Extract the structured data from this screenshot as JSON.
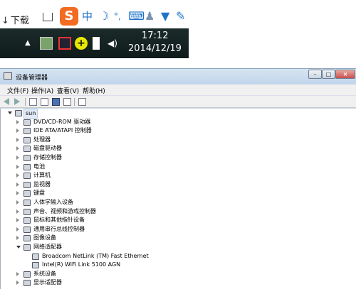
{
  "browser": {
    "download_label": "下载"
  },
  "ime": {
    "logo": "S",
    "mode_label": "中",
    "icons": [
      "moon-icon",
      "punctuation-icon",
      "keyboard-icon",
      "user-icon",
      "shirt-icon",
      "wrench-icon"
    ]
  },
  "taskbar": {
    "time": "17:12",
    "date": "2014/12/19",
    "tray_icons": [
      "show-hidden-icons-arrow",
      "app-tray-icon",
      "network-warning-icon",
      "plus-icon",
      "device-icon",
      "volume-icon"
    ]
  },
  "window": {
    "title": "设备管理器",
    "controls": [
      "minimize",
      "maximize",
      "close"
    ]
  },
  "menu": {
    "items": [
      "文件(F)",
      "操作(A)",
      "查看(V)",
      "帮助(H)"
    ]
  },
  "tree": {
    "root": "sun",
    "items": [
      {
        "label": "DVD/CD-ROM 驱动器",
        "icon": "dvd-icon",
        "expanded": false
      },
      {
        "label": "IDE ATA/ATAPI 控制器",
        "icon": "ide-icon",
        "expanded": false
      },
      {
        "label": "处理器",
        "icon": "cpu-icon",
        "expanded": false
      },
      {
        "label": "磁盘驱动器",
        "icon": "disk-icon",
        "expanded": false
      },
      {
        "label": "存储控制器",
        "icon": "storage-icon",
        "expanded": false
      },
      {
        "label": "电池",
        "icon": "battery-icon",
        "expanded": false
      },
      {
        "label": "计算机",
        "icon": "computer-icon",
        "expanded": false
      },
      {
        "label": "监视器",
        "icon": "monitor-icon",
        "expanded": false
      },
      {
        "label": "键盘",
        "icon": "keyboard-icon",
        "expanded": false
      },
      {
        "label": "人体学输入设备",
        "icon": "hid-icon",
        "expanded": false
      },
      {
        "label": "声音、视频和游戏控制器",
        "icon": "sound-icon",
        "expanded": false
      },
      {
        "label": "鼠标和其他指针设备",
        "icon": "mouse-icon",
        "expanded": false
      },
      {
        "label": "通用串行总线控制器",
        "icon": "usb-icon",
        "expanded": false
      },
      {
        "label": "图像设备",
        "icon": "camera-icon",
        "expanded": false
      },
      {
        "label": "网络适配器",
        "icon": "network-icon",
        "expanded": true
      },
      {
        "label": "Broadcom NetLink (TM) Fast Ethernet",
        "icon": "network-adapter-icon",
        "child": true
      },
      {
        "label": "Intel(R) WiFi Link 5100 AGN",
        "icon": "network-adapter-icon",
        "child": true
      },
      {
        "label": "系统设备",
        "icon": "system-icon",
        "expanded": false
      },
      {
        "label": "显示适配器",
        "icon": "display-icon",
        "expanded": false
      }
    ]
  }
}
